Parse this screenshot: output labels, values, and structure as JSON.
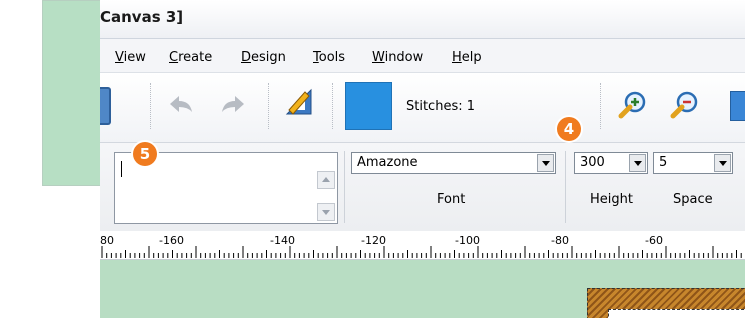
{
  "window": {
    "title": "Canvas 3]"
  },
  "menu": [
    {
      "label_pre": "",
      "label_u": "V",
      "label_post": "iew"
    },
    {
      "label_pre": "",
      "label_u": "C",
      "label_post": "reate"
    },
    {
      "label_pre": "",
      "label_u": "D",
      "label_post": "esign"
    },
    {
      "label_pre": "",
      "label_u": "T",
      "label_post": "ools"
    },
    {
      "label_pre": "",
      "label_u": "W",
      "label_post": "indow"
    },
    {
      "label_pre": "",
      "label_u": "H",
      "label_post": "elp"
    }
  ],
  "toolbar": {
    "stitches_label": "Stitches: 1",
    "color_swatch": "#2890e0",
    "icons": [
      "save-icon",
      "undo-icon",
      "redo-icon",
      "draw-icon",
      "zoom-in-icon",
      "zoom-out-icon"
    ]
  },
  "fontbar": {
    "text_value": "",
    "font_value": "Amazone",
    "font_label": "Font",
    "height_value": "300",
    "height_label": "Height",
    "space_value": "5",
    "space_label": "Space"
  },
  "ruler": {
    "labels": [
      "80",
      "-160",
      "-140",
      "-120",
      "-100",
      "-80",
      "-60"
    ]
  },
  "callouts": {
    "four": "4",
    "five": "5"
  },
  "colors": {
    "accent": "#f07b1f",
    "canvas": "#b8ddc3",
    "stitch": "#c7862c"
  }
}
